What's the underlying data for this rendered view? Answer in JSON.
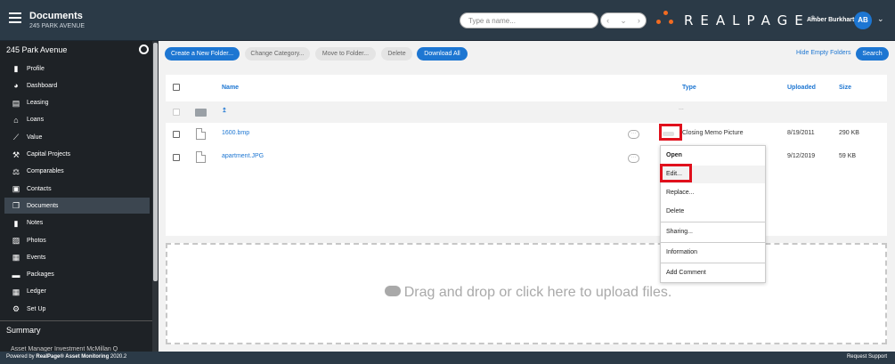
{
  "header": {
    "title": "Documents",
    "subtitle": "245 PARK AVENUE",
    "search_placeholder": "Type a name...",
    "logo_text": "REALPAGE",
    "logo_mark": "®",
    "user_name": "Amber Burkhart",
    "user_initials": "AB"
  },
  "sidebar": {
    "property": "245 Park Avenue",
    "items": [
      {
        "label": "Profile",
        "icon": "profile-icon",
        "glyph": "▮"
      },
      {
        "label": "Dashboard",
        "icon": "dashboard-icon",
        "glyph": "◕"
      },
      {
        "label": "Leasing",
        "icon": "leasing-icon",
        "glyph": "▤"
      },
      {
        "label": "Loans",
        "icon": "loans-icon",
        "glyph": "⌂"
      },
      {
        "label": "Value",
        "icon": "value-icon",
        "glyph": "⟋"
      },
      {
        "label": "Capital Projects",
        "icon": "hammer-icon",
        "glyph": "⚒"
      },
      {
        "label": "Comparables",
        "icon": "scale-icon",
        "glyph": "⚖"
      },
      {
        "label": "Contacts",
        "icon": "contacts-icon",
        "glyph": "▣"
      },
      {
        "label": "Documents",
        "icon": "documents-icon",
        "glyph": "❐"
      },
      {
        "label": "Notes",
        "icon": "notes-icon",
        "glyph": "▮"
      },
      {
        "label": "Photos",
        "icon": "photos-icon",
        "glyph": "▨"
      },
      {
        "label": "Events",
        "icon": "calendar-icon",
        "glyph": "▦"
      },
      {
        "label": "Packages",
        "icon": "packages-icon",
        "glyph": "▬"
      },
      {
        "label": "Ledger",
        "icon": "ledger-icon",
        "glyph": "▦"
      },
      {
        "label": "Set Up",
        "icon": "gear-icon",
        "glyph": "⚙"
      }
    ],
    "active": "Documents",
    "summary": "Summary",
    "summary_row": "Asset Manager     Investment McMillan Q"
  },
  "toolbar": {
    "create_folder": "Create a New Folder...",
    "change_category": "Change Category...",
    "move_to_folder": "Move to Folder...",
    "delete": "Delete",
    "download_all": "Download All",
    "hide_empty": "Hide Empty Folders",
    "search": "Search"
  },
  "table": {
    "columns": {
      "name": "Name",
      "type": "Type",
      "uploaded": "Uploaded",
      "size": "Size"
    },
    "parent_row": {
      "name": "↥",
      "type_dots": "..."
    },
    "rows": [
      {
        "name": "1600.bmp",
        "type": "Closing Memo Picture",
        "uploaded": "8/19/2011",
        "size": "290 KB"
      },
      {
        "name": "apartment.JPG",
        "type": "",
        "uploaded": "9/12/2019",
        "size": "59 KB"
      }
    ]
  },
  "context_menu": {
    "items": [
      "Open",
      "Edit...",
      "Replace...",
      "Delete",
      "Sharing...",
      "Information",
      "Add Comment"
    ]
  },
  "upload": {
    "text": "Drag and drop or click here to upload files."
  },
  "footer": {
    "powered_prefix": "Powered by ",
    "powered_brand": "RealPage® Asset Monitoring",
    "powered_version": " 2020.2",
    "request_support": "Request Support"
  },
  "colors": {
    "accent": "#1d76d2",
    "highlight": "#e0101c",
    "brand_orange": "#f26b21"
  }
}
